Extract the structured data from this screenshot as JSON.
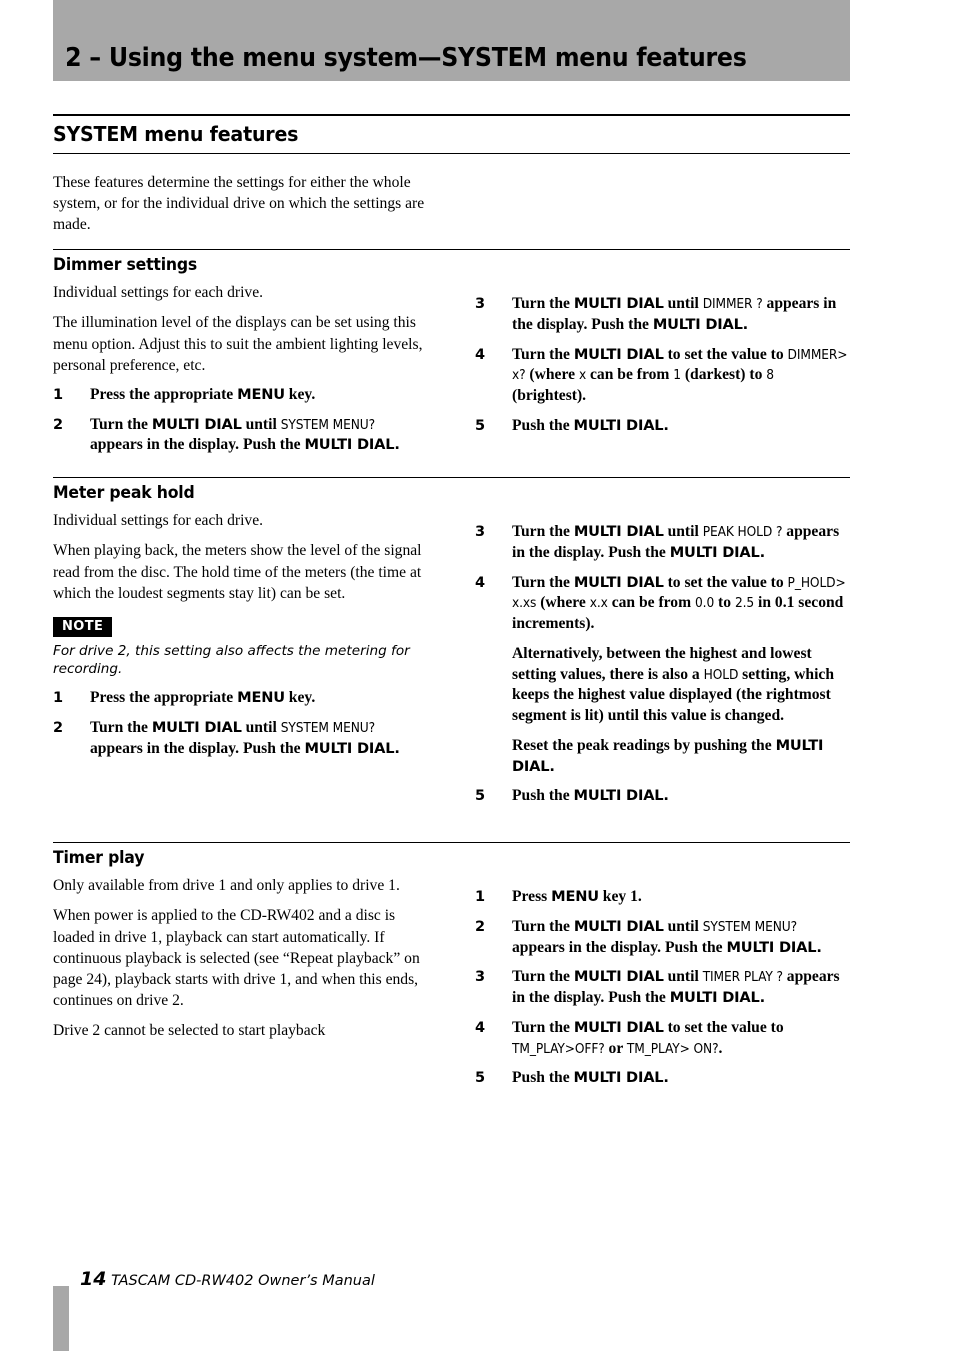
{
  "page": {
    "running_head": "2 – Using the menu system—SYSTEM menu features",
    "main_heading": "SYSTEM menu features",
    "intro": "These features determine the settings for either the whole system, or for the individual drive on which the settings are made."
  },
  "sections": [
    {
      "id": "dimmer-settings",
      "heading": "Dimmer settings",
      "left": {
        "paragraphs": [
          "Individual settings for each drive.",
          "The illumination level of the displays can be set using this menu option. Adjust this to suit the ambient lighting levels, personal preference, etc."
        ],
        "steps": [
          {
            "num": "1",
            "parts": [
              {
                "t": "Press the appropriate ",
                "s": "serif-b"
              },
              {
                "t": "MENU",
                "s": "sans-b"
              },
              {
                "t": " key.",
                "s": "serif-b"
              }
            ]
          },
          {
            "num": "2",
            "parts": [
              {
                "t": "Turn the ",
                "s": "serif-b"
              },
              {
                "t": "MULTI DIAL",
                "s": "sans-b"
              },
              {
                "t": " until ",
                "s": "serif-b"
              },
              {
                "t": "SYSTEM MENU?",
                "s": "disp"
              },
              {
                "t": " appears in the display. Push the ",
                "s": "serif-b"
              },
              {
                "t": "MULTI DIAL.",
                "s": "sans-b"
              }
            ]
          }
        ]
      },
      "right": {
        "steps": [
          {
            "num": "3",
            "parts": [
              {
                "t": "Turn the ",
                "s": "serif-b"
              },
              {
                "t": "MULTI DIAL",
                "s": "sans-b"
              },
              {
                "t": " until ",
                "s": "serif-b"
              },
              {
                "t": "DIMMER   ?",
                "s": "disp"
              },
              {
                "t": " appears in the display. Push the ",
                "s": "serif-b"
              },
              {
                "t": "MULTI DIAL.",
                "s": "sans-b"
              }
            ]
          },
          {
            "num": "4",
            "parts": [
              {
                "t": "Turn the ",
                "s": "serif-b"
              },
              {
                "t": "MULTI DIAL",
                "s": "sans-b"
              },
              {
                "t": " to set the value to ",
                "s": "serif-b"
              },
              {
                "t": "DIMMER>  x?",
                "s": "disp"
              },
              {
                "t": " (where ",
                "s": "serif-b"
              },
              {
                "t": "x",
                "s": "disp"
              },
              {
                "t": " can be from ",
                "s": "serif-b"
              },
              {
                "t": "1",
                "s": "disp"
              },
              {
                "t": " (darkest) to ",
                "s": "serif-b"
              },
              {
                "t": "8",
                "s": "disp"
              },
              {
                "t": " (brightest).",
                "s": "serif-b"
              }
            ]
          },
          {
            "num": "5",
            "parts": [
              {
                "t": "Push the ",
                "s": "serif-b"
              },
              {
                "t": "MULTI DIAL.",
                "s": "sans-b"
              }
            ]
          }
        ]
      }
    },
    {
      "id": "meter-peak-hold",
      "heading": "Meter peak hold",
      "left": {
        "paragraphs": [
          "Individual settings for each drive.",
          "When playing back, the meters show the level of the signal read from the disc. The hold time of the meters (the time at which the loudest segments stay lit) can be set."
        ],
        "note_label": "NOTE",
        "note_text": "For drive 2, this setting also affects the metering for recording.",
        "steps": [
          {
            "num": "1",
            "parts": [
              {
                "t": "Press the appropriate ",
                "s": "serif-b"
              },
              {
                "t": "MENU",
                "s": "sans-b"
              },
              {
                "t": " key.",
                "s": "serif-b"
              }
            ]
          },
          {
            "num": "2",
            "parts": [
              {
                "t": "Turn the ",
                "s": "serif-b"
              },
              {
                "t": "MULTI DIAL",
                "s": "sans-b"
              },
              {
                "t": " until ",
                "s": "serif-b"
              },
              {
                "t": "SYSTEM MENU?",
                "s": "disp"
              },
              {
                "t": " appears in the display. Push the ",
                "s": "serif-b"
              },
              {
                "t": "MULTI DIAL.",
                "s": "sans-b"
              }
            ]
          }
        ]
      },
      "right": {
        "steps": [
          {
            "num": "3",
            "parts": [
              {
                "t": "Turn the ",
                "s": "serif-b"
              },
              {
                "t": "MULTI DIAL",
                "s": "sans-b"
              },
              {
                "t": " until ",
                "s": "serif-b"
              },
              {
                "t": "PEAK HOLD  ?",
                "s": "disp"
              },
              {
                "t": " appears in the display. Push the ",
                "s": "serif-b"
              },
              {
                "t": "MULTI DIAL.",
                "s": "sans-b"
              }
            ]
          },
          {
            "num": "4",
            "parts": [
              {
                "t": "Turn the ",
                "s": "serif-b"
              },
              {
                "t": "MULTI DIAL",
                "s": "sans-b"
              },
              {
                "t": " to set the value to ",
                "s": "serif-b"
              },
              {
                "t": "P_HOLD> x.xs",
                "s": "disp"
              },
              {
                "t": " (where ",
                "s": "serif-b"
              },
              {
                "t": "x.x",
                "s": "disp"
              },
              {
                "t": " can be from ",
                "s": "serif-b"
              },
              {
                "t": "0.0",
                "s": "disp"
              },
              {
                "t": " to ",
                "s": "serif-b"
              },
              {
                "t": "2.5",
                "s": "disp"
              },
              {
                "t": " in 0.1 second increments).",
                "s": "serif-b"
              }
            ]
          },
          {
            "num": "",
            "cont": true,
            "parts": [
              {
                "t": "Alternatively, between the highest and lowest setting values, there is also a ",
                "s": "serif-b"
              },
              {
                "t": "HOLD",
                "s": "disp"
              },
              {
                "t": " setting, which keeps the highest value displayed (the rightmost segment is lit) until this value is changed.",
                "s": "serif-b"
              }
            ]
          },
          {
            "num": "",
            "cont": true,
            "parts": [
              {
                "t": "Reset the peak readings by pushing the ",
                "s": "serif-b"
              },
              {
                "t": "MULTI DIAL.",
                "s": "sans-b"
              }
            ]
          },
          {
            "num": "5",
            "parts": [
              {
                "t": "Push the ",
                "s": "serif-b"
              },
              {
                "t": "MULTI DIAL.",
                "s": "sans-b"
              }
            ]
          }
        ]
      }
    },
    {
      "id": "timer-play",
      "heading": "Timer play",
      "left": {
        "paragraphs": [
          "Only available from drive 1 and only applies to drive 1.",
          "When power is applied to the CD-RW402 and a disc is loaded in drive 1, playback can start automatically. If continuous playback is selected (see “Repeat playback” on page 24), playback starts with drive 1, and when this ends, continues on drive 2.",
          "Drive 2 cannot be selected to start playback"
        ],
        "steps": []
      },
      "right": {
        "steps": [
          {
            "num": "1",
            "parts": [
              {
                "t": "Press ",
                "s": "serif-b"
              },
              {
                "t": "MENU",
                "s": "sans-b"
              },
              {
                "t": " key 1.",
                "s": "serif-b"
              }
            ]
          },
          {
            "num": "2",
            "parts": [
              {
                "t": "Turn the ",
                "s": "serif-b"
              },
              {
                "t": "MULTI DIAL",
                "s": "sans-b"
              },
              {
                "t": " until ",
                "s": "serif-b"
              },
              {
                "t": "SYSTEM MENU?",
                "s": "disp"
              },
              {
                "t": " appears in the display. Push the ",
                "s": "serif-b"
              },
              {
                "t": "MULTI DIAL.",
                "s": "sans-b"
              }
            ]
          },
          {
            "num": "3",
            "parts": [
              {
                "t": "Turn the ",
                "s": "serif-b"
              },
              {
                "t": "MULTI DIAL",
                "s": "sans-b"
              },
              {
                "t": " until ",
                "s": "serif-b"
              },
              {
                "t": "TIMER PLAY ?",
                "s": "disp"
              },
              {
                "t": " appears in the display. Push the ",
                "s": "serif-b"
              },
              {
                "t": "MULTI DIAL.",
                "s": "sans-b"
              }
            ]
          },
          {
            "num": "4",
            "parts": [
              {
                "t": "Turn the ",
                "s": "serif-b"
              },
              {
                "t": "MULTI DIAL",
                "s": "sans-b"
              },
              {
                "t": " to set the value to ",
                "s": "serif-b"
              },
              {
                "t": "TM_PLAY>OFF?",
                "s": "disp"
              },
              {
                "t": " or ",
                "s": "serif-b"
              },
              {
                "t": "TM_PLAY> ON?",
                "s": "disp"
              },
              {
                "t": ".",
                "s": "serif-b"
              }
            ]
          },
          {
            "num": "5",
            "parts": [
              {
                "t": "Push the ",
                "s": "serif-b"
              },
              {
                "t": "MULTI DIAL.",
                "s": "sans-b"
              }
            ]
          }
        ]
      }
    }
  ],
  "footer": {
    "page_number": "14",
    "manual_name": "TASCAM CD-RW402 Owner’s Manual"
  },
  "colors": {
    "band_gray": "#a8a8a8",
    "rule_black": "#000000",
    "paper": "#ffffff"
  }
}
